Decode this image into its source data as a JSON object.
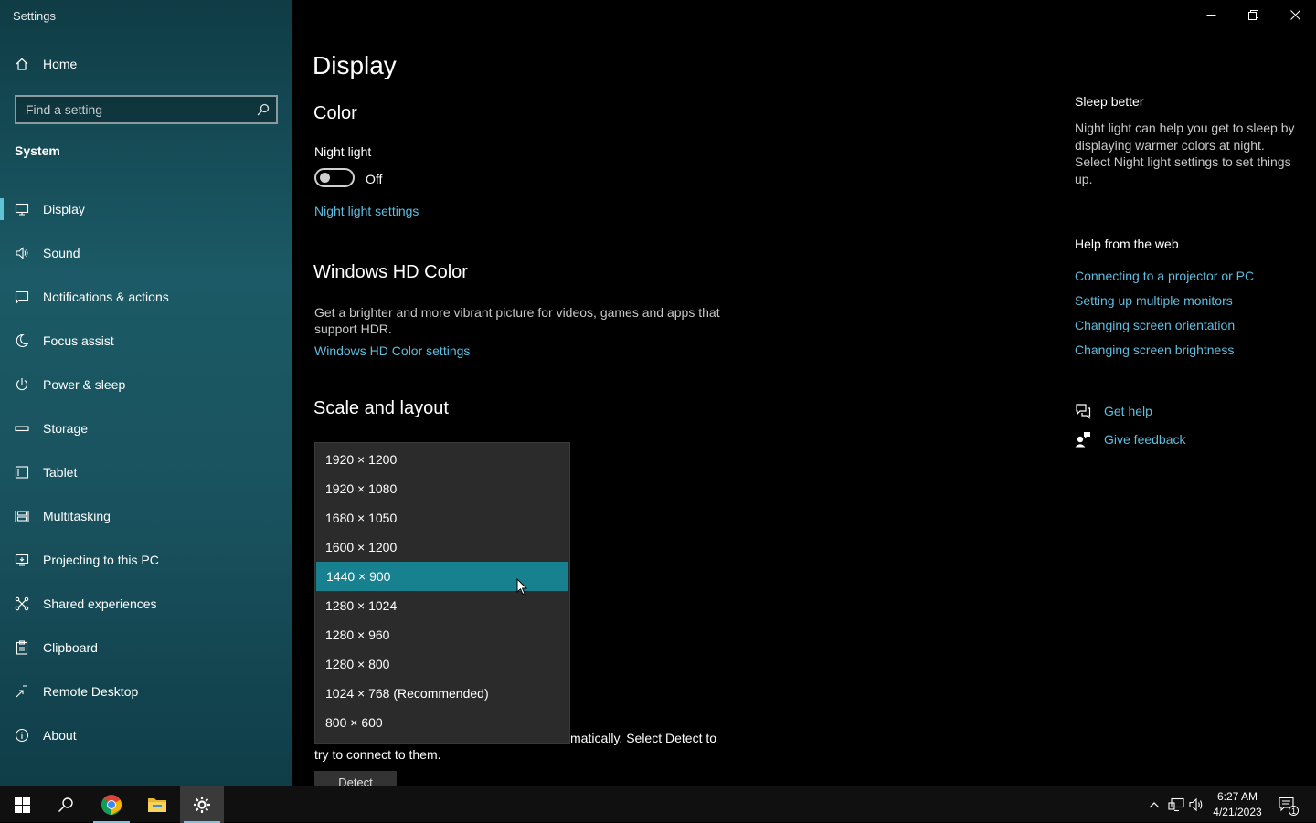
{
  "app": {
    "title": "Settings"
  },
  "sidebar": {
    "home_label": "Home",
    "search_placeholder": "Find a setting",
    "section": "System",
    "items": [
      {
        "label": "Display",
        "icon": "monitor-icon"
      },
      {
        "label": "Sound",
        "icon": "speaker-icon"
      },
      {
        "label": "Notifications & actions",
        "icon": "notification-icon"
      },
      {
        "label": "Focus assist",
        "icon": "moon-icon"
      },
      {
        "label": "Power & sleep",
        "icon": "power-icon"
      },
      {
        "label": "Storage",
        "icon": "storage-icon"
      },
      {
        "label": "Tablet",
        "icon": "tablet-icon"
      },
      {
        "label": "Multitasking",
        "icon": "multitasking-icon"
      },
      {
        "label": "Projecting to this PC",
        "icon": "projecting-icon"
      },
      {
        "label": "Shared experiences",
        "icon": "shared-icon"
      },
      {
        "label": "Clipboard",
        "icon": "clipboard-icon"
      },
      {
        "label": "Remote Desktop",
        "icon": "remote-desktop-icon"
      },
      {
        "label": "About",
        "icon": "info-icon"
      }
    ]
  },
  "main": {
    "title": "Display",
    "color": {
      "heading": "Color",
      "night_light_label": "Night light",
      "toggle_state": "Off",
      "night_light_settings_link": "Night light settings"
    },
    "hdr": {
      "heading": "Windows HD Color",
      "description": "Get a brighter and more vibrant picture for videos, games and apps that support HDR.",
      "settings_link": "Windows HD Color settings"
    },
    "scale": {
      "heading": "Scale and layout"
    },
    "multiple": {
      "description_visible_tail": "matically. Select Detect to",
      "description_line2": "try to connect to them.",
      "detect_button": "Detect"
    },
    "resolution_dropdown": {
      "options": [
        "1920 × 1200",
        "1920 × 1080",
        "1680 × 1050",
        "1600 × 1200",
        "1440 × 900",
        "1280 × 1024",
        "1280 × 960",
        "1280 × 800",
        "1024 × 768 (Recommended)",
        "800 × 600"
      ],
      "selected": "1440 × 900"
    }
  },
  "right_panel": {
    "sleep_title": "Sleep better",
    "sleep_text": "Night light can help you get to sleep by displaying warmer colors at night. Select Night light settings to set things up.",
    "web_title": "Help from the web",
    "web_links": [
      "Connecting to a projector or PC",
      "Setting up multiple monitors",
      "Changing screen orientation",
      "Changing screen brightness"
    ],
    "get_help": "Get help",
    "give_feedback": "Give feedback"
  },
  "taskbar": {
    "time": "6:27 AM",
    "date": "4/21/2023",
    "notification_count": "1"
  },
  "colors": {
    "accent": "#17818f",
    "link": "#5fbde0",
    "sidebar": "#1b5a66"
  }
}
